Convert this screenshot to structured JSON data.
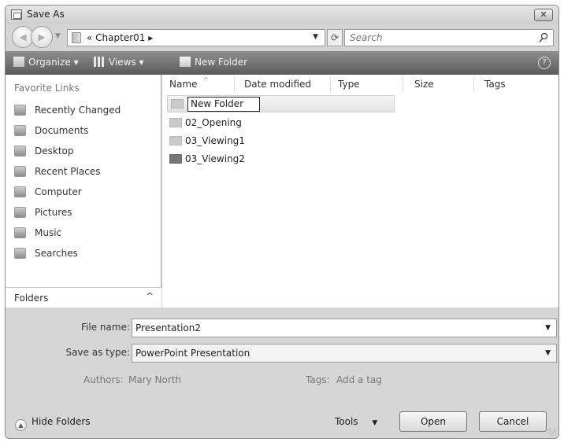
{
  "window": {
    "title": "Save As"
  },
  "address": {
    "prefix": "«",
    "path": "Chapter01",
    "sep": "▸"
  },
  "search": {
    "placeholder": "Search"
  },
  "toolbar": {
    "organize": "Organize ▾",
    "views": "Views ▾",
    "new_folder": "New Folder",
    "help": "?"
  },
  "sidebar": {
    "title": "Favorite Links",
    "items": [
      {
        "label": "Recently Changed",
        "icon": "recently-changed-icon"
      },
      {
        "label": "Documents",
        "icon": "documents-icon"
      },
      {
        "label": "Desktop",
        "icon": "desktop-icon"
      },
      {
        "label": "Recent Places",
        "icon": "recent-places-icon"
      },
      {
        "label": "Computer",
        "icon": "computer-icon"
      },
      {
        "label": "Pictures",
        "icon": "pictures-icon"
      },
      {
        "label": "Music",
        "icon": "music-icon"
      },
      {
        "label": "Searches",
        "icon": "searches-icon"
      }
    ],
    "folders_label": "Folders",
    "folders_chevron": "^"
  },
  "columns": [
    "Name",
    "Date modified",
    "Type",
    "Size",
    "Tags"
  ],
  "files": [
    {
      "name": "New Folder",
      "editing": true
    },
    {
      "name": "02_Opening"
    },
    {
      "name": "03_Viewing1"
    },
    {
      "name": "03_Viewing2"
    }
  ],
  "form": {
    "file_name_label": "File name:",
    "file_name_value": "Presentation2",
    "save_type_label": "Save as type:",
    "save_type_value": "PowerPoint Presentation",
    "authors_label": "Authors:",
    "authors_value": "Mary North",
    "tags_label": "Tags:",
    "tags_value": "Add a tag"
  },
  "footer": {
    "hide_folders": "Hide Folders",
    "tools": "Tools",
    "open": "Open",
    "cancel": "Cancel"
  }
}
